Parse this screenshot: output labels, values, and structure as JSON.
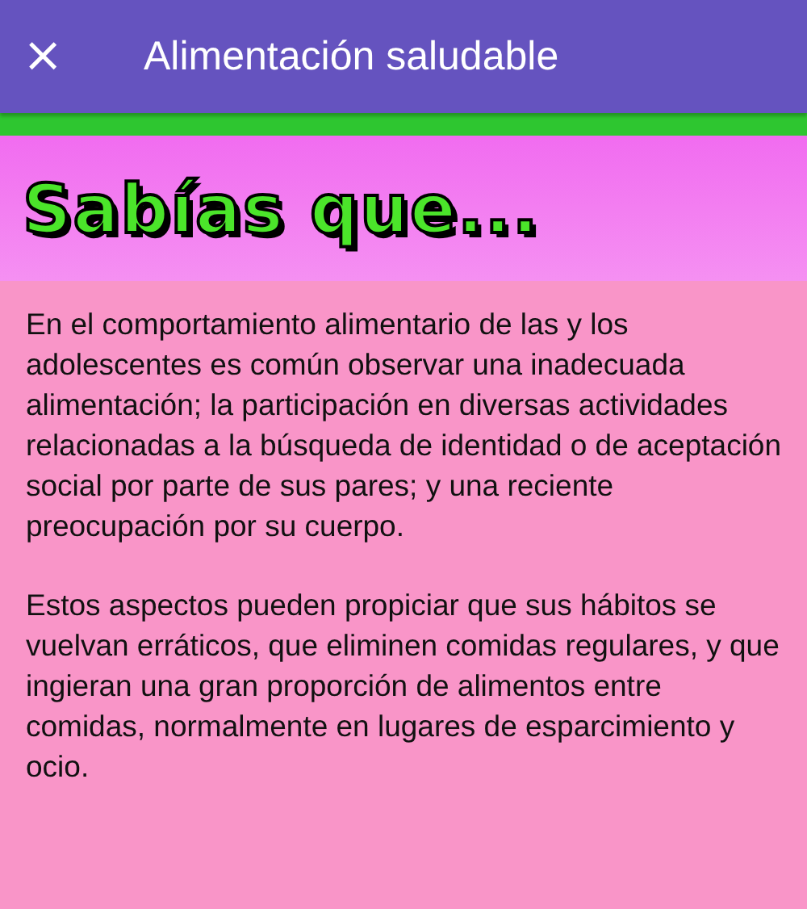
{
  "app_bar": {
    "close": "×",
    "title": "Alimentación saludable"
  },
  "heading": "Sabías que...",
  "paragraphs": [
    "En el comportamiento alimentario de las y los adolescentes es común observar una inadecuada alimentación; la participación en diversas actividades relacionadas a la búsqueda de identidad o de aceptación social por parte de sus pares; y una reciente preocupación por su cuerpo.",
    "Estos aspectos pueden propiciar que sus hábitos se vuelvan erráticos, que eliminen comidas regulares, y que ingieran una gran proporción de alimentos entre comidas, normalmente en lugares de esparcimiento y ocio."
  ]
}
